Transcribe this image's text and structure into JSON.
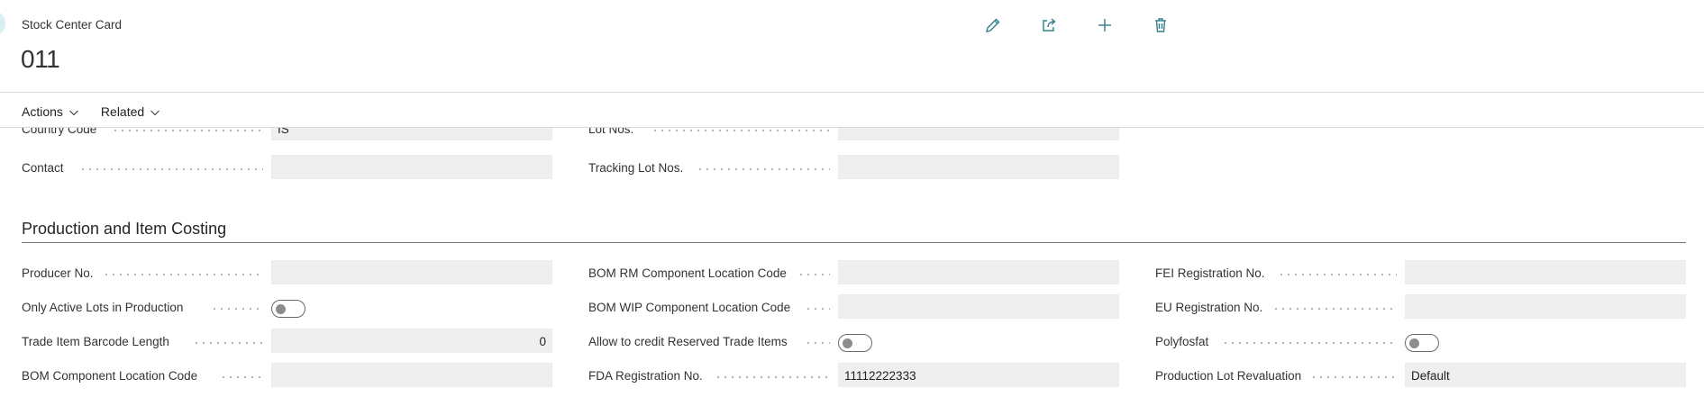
{
  "page": {
    "caption": "Stock Center Card",
    "record_no": "011"
  },
  "toolbar": {
    "icons": [
      "pencil-icon",
      "share-icon",
      "plus-icon",
      "trash-icon"
    ],
    "accent": "#30808a"
  },
  "action_bar": {
    "actions_label": "Actions",
    "related_label": "Related"
  },
  "general": {
    "country_code_label": "Country Code",
    "country_code_value": "IS",
    "lot_nos_label": "Lot Nos.",
    "lot_nos_value": "",
    "contact_label": "Contact",
    "contact_value": "",
    "tracking_lot_nos_label": "Tracking Lot Nos.",
    "tracking_lot_nos_value": ""
  },
  "production": {
    "title": "Production and Item Costing",
    "col1": [
      {
        "label": "Producer No.",
        "value": ""
      },
      {
        "label": "Only Active Lots in Production",
        "toggle": false
      },
      {
        "label": "Trade Item Barcode Length",
        "value": "0"
      },
      {
        "label": "BOM Component Location Code",
        "value": ""
      }
    ],
    "col2": [
      {
        "label": "BOM RM Component Location Code",
        "value": ""
      },
      {
        "label": "BOM WIP Component Location Code",
        "value": ""
      },
      {
        "label": "Allow to credit Reserved Trade Items",
        "toggle": false
      },
      {
        "label": "FDA Registration No.",
        "value": "11112222333"
      }
    ],
    "col3": [
      {
        "label": "FEI Registration No.",
        "value": ""
      },
      {
        "label": "EU Registration No.",
        "value": ""
      },
      {
        "label": "Polyfosfat",
        "toggle": false
      },
      {
        "label": "Production Lot Revaluation",
        "value": "Default"
      }
    ]
  }
}
